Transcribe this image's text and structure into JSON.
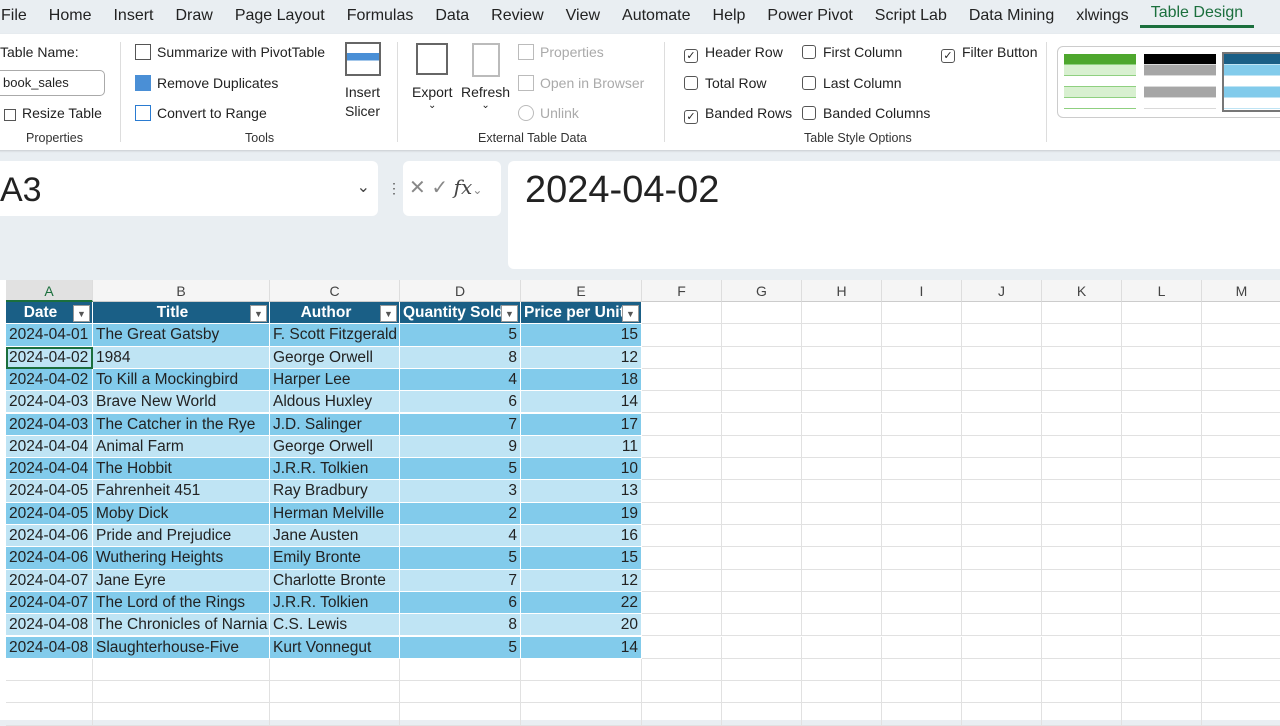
{
  "menu": [
    "File",
    "Home",
    "Insert",
    "Draw",
    "Page Layout",
    "Formulas",
    "Data",
    "Review",
    "View",
    "Automate",
    "Help",
    "Power Pivot",
    "Script Lab",
    "Data Mining",
    "xlwings",
    "Table Design"
  ],
  "ribbon": {
    "table_name_label": "Table Name:",
    "table_name_value": "book_sales",
    "resize_table": "Resize Table",
    "properties_group": "Properties",
    "summarize": "Summarize with PivotTable",
    "remove_duplicates": "Remove Duplicates",
    "convert_range": "Convert to Range",
    "insert_slicer_1": "Insert",
    "insert_slicer_2": "Slicer",
    "tools_group": "Tools",
    "export": "Export",
    "refresh": "Refresh",
    "properties": "Properties",
    "open_browser": "Open in Browser",
    "unlink": "Unlink",
    "external_group": "External Table Data",
    "options": [
      {
        "label": "Header Row",
        "checked": true
      },
      {
        "label": "Total Row",
        "checked": false
      },
      {
        "label": "Banded Rows",
        "checked": true
      },
      {
        "label": "First Column",
        "checked": false
      },
      {
        "label": "Last Column",
        "checked": false
      },
      {
        "label": "Banded Columns",
        "checked": false
      },
      {
        "label": "Filter Button",
        "checked": true
      }
    ],
    "style_options_group": "Table Style Options",
    "styles": [
      {
        "header": "#4ea72e",
        "band": "#d8f0d0",
        "line": "#8fd080"
      },
      {
        "header": "#000000",
        "band": "#a6a6a6",
        "line": "#d9d9d9"
      },
      {
        "header": "#1a5f86",
        "band": "#82cbeb",
        "line": "#bfe4f4"
      }
    ]
  },
  "name_box": "A3",
  "formula": "2024-04-02",
  "fx": "fx",
  "columns": [
    "A",
    "B",
    "C",
    "D",
    "E",
    "F",
    "G",
    "H",
    "I",
    "J",
    "K",
    "L",
    "M"
  ],
  "headers": [
    "Date",
    "Title",
    "Author",
    "Quantity Sold",
    "Price per Unit"
  ],
  "rows": [
    [
      "2024-04-01",
      "The Great Gatsby",
      "F. Scott Fitzgerald",
      "5",
      "15"
    ],
    [
      "2024-04-02",
      "1984",
      "George Orwell",
      "8",
      "12"
    ],
    [
      "2024-04-02",
      "To Kill a Mockingbird",
      "Harper Lee",
      "4",
      "18"
    ],
    [
      "2024-04-03",
      "Brave New World",
      "Aldous Huxley",
      "6",
      "14"
    ],
    [
      "2024-04-03",
      "The Catcher in the Rye",
      "J.D. Salinger",
      "7",
      "17"
    ],
    [
      "2024-04-04",
      "Animal Farm",
      "George Orwell",
      "9",
      "11"
    ],
    [
      "2024-04-04",
      "The Hobbit",
      "J.R.R. Tolkien",
      "5",
      "10"
    ],
    [
      "2024-04-05",
      "Fahrenheit 451",
      "Ray Bradbury",
      "3",
      "13"
    ],
    [
      "2024-04-05",
      "Moby Dick",
      "Herman Melville",
      "2",
      "19"
    ],
    [
      "2024-04-06",
      "Pride and Prejudice",
      "Jane Austen",
      "4",
      "16"
    ],
    [
      "2024-04-06",
      "Wuthering Heights",
      "Emily Bronte",
      "5",
      "15"
    ],
    [
      "2024-04-07",
      "Jane Eyre",
      "Charlotte Bronte",
      "7",
      "12"
    ],
    [
      "2024-04-07",
      "The Lord of the Rings",
      "J.R.R. Tolkien",
      "6",
      "22"
    ],
    [
      "2024-04-08",
      "The Chronicles of Narnia",
      "C.S. Lewis",
      "8",
      "20"
    ],
    [
      "2024-04-08",
      "Slaughterhouse-Five",
      "Kurt Vonnegut",
      "5",
      "14"
    ]
  ]
}
